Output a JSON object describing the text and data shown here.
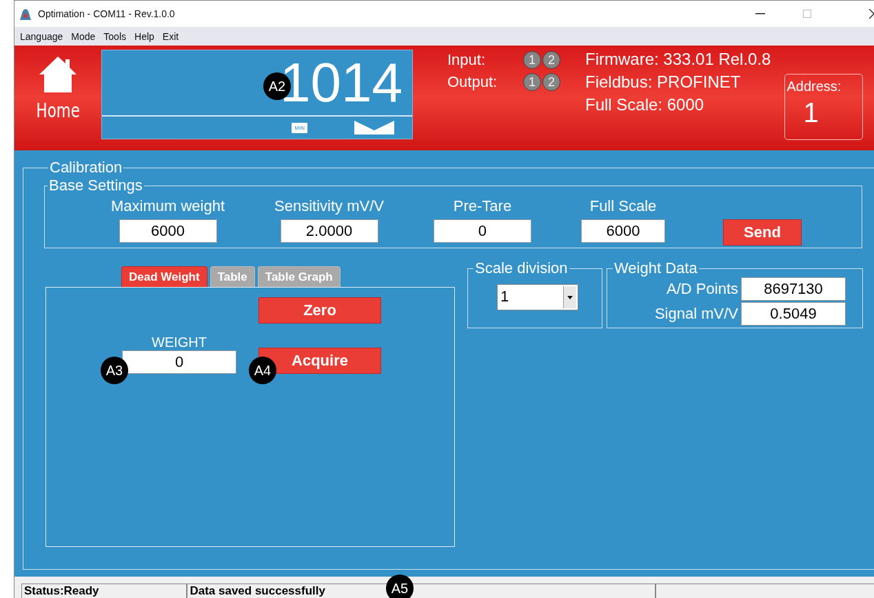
{
  "window": {
    "title": "Optimation - COM11 - Rev.1.0.0"
  },
  "menu": [
    "Language",
    "Mode",
    "Tools",
    "Help",
    "Exit"
  ],
  "header": {
    "home_label": "Home",
    "display_value": "1014",
    "min_indicator": "MIN",
    "io": [
      {
        "label": "Input:",
        "channels": [
          {
            "number": "1",
            "on": false
          },
          {
            "number": "2",
            "on": false
          }
        ]
      },
      {
        "label": "Output:",
        "channels": [
          {
            "number": "1",
            "on": false
          },
          {
            "number": "2",
            "on": false
          }
        ]
      }
    ],
    "info": [
      "Firmware: 333.01 Rel.0.8",
      "Fieldbus: PROFINET",
      "Full Scale: 6000"
    ],
    "address": {
      "label": "Address:",
      "value": "1"
    }
  },
  "calibration": {
    "title": "Calibration",
    "base_settings": {
      "title": "Base Settings",
      "fields": [
        {
          "label": "Maximum weight",
          "value": "6000"
        },
        {
          "label": "Sensitivity mV/V",
          "value": "2.0000"
        },
        {
          "label": "Pre-Tare",
          "value": "0"
        },
        {
          "label": "Full Scale",
          "value": "6000"
        }
      ],
      "send": "Send"
    },
    "tabs": [
      {
        "label": "Dead Weight",
        "selected": true
      },
      {
        "label": "Table",
        "selected": false
      },
      {
        "label": "Table Graph",
        "selected": false
      }
    ],
    "dead_weight": {
      "zero": "Zero",
      "weight_label": "WEIGHT",
      "weight_value": "0",
      "acquire": "Acquire"
    },
    "scale_division": {
      "title": "Scale division",
      "value": "1"
    },
    "weight_data": {
      "title": "Weight Data",
      "rows": [
        {
          "label": "A/D Points",
          "value": "8697130"
        },
        {
          "label": "Signal mV/V",
          "value": "0.5049"
        }
      ]
    }
  },
  "status_bar": [
    "Status:Ready",
    "Data saved successfully"
  ],
  "callouts": [
    "A2",
    "A3",
    "A4",
    "A5"
  ]
}
